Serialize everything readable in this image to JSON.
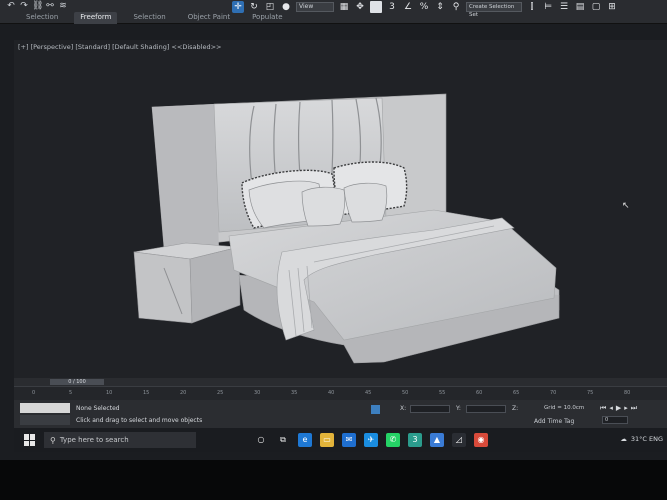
{
  "ribbon": {
    "tabs": [
      "Selection",
      "Freeform",
      "Selection",
      "Object Paint",
      "Populate"
    ],
    "active_tab": 1,
    "view_dropdown": "View",
    "selection_set": "Create Selection Set"
  },
  "viewport": {
    "label": "[+] [Perspective] [Standard] [Default Shading] <<Disabled>>"
  },
  "timeline": {
    "frame_readout": "0 / 100",
    "ticks": [
      "0",
      "5",
      "10",
      "15",
      "20",
      "25",
      "30",
      "35",
      "40",
      "45",
      "50",
      "55",
      "60",
      "65",
      "70",
      "75",
      "80"
    ]
  },
  "status": {
    "selection": "None Selected",
    "prompt": "Click and drag to select and move objects",
    "x_label": "X:",
    "y_label": "Y:",
    "z_label": "Z:",
    "grid": "Grid = 10.0cm",
    "add_tag": "Add Time Tag",
    "frame": "0"
  },
  "taskbar": {
    "search_placeholder": "Type here to search",
    "tray_text": "31°C  ENG"
  },
  "colors": {
    "accent": "#2f6fb3",
    "viewport_bg": "#202226",
    "bed": "#c9cacc"
  }
}
